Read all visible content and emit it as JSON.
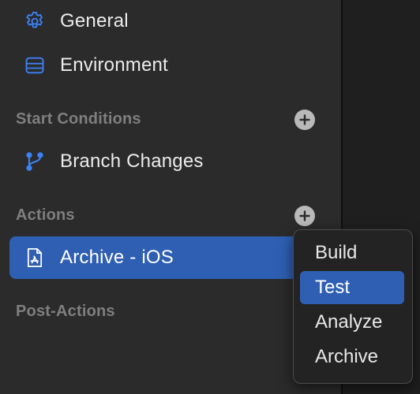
{
  "sidebar": {
    "items": [
      {
        "label": "General",
        "icon": "gear-icon"
      },
      {
        "label": "Environment",
        "icon": "server-icon"
      }
    ],
    "start_conditions": {
      "header": "Start Conditions",
      "add_icon": "plus-circle-icon",
      "items": [
        {
          "label": "Branch Changes",
          "icon": "branch-icon"
        }
      ]
    },
    "actions": {
      "header": "Actions",
      "add_icon": "plus-circle-icon",
      "items": [
        {
          "label": "Archive - iOS",
          "icon": "app-store-icon",
          "selected": true
        }
      ]
    },
    "post_actions": {
      "header": "Post-Actions"
    }
  },
  "menu": {
    "items": [
      "Build",
      "Test",
      "Analyze",
      "Archive"
    ],
    "highlighted": "Test"
  },
  "colors": {
    "accent": "#2f5fb3",
    "icon_blue": "#3b82f6",
    "sidebar_bg": "#2b2b2b",
    "menu_bg": "#232323"
  }
}
